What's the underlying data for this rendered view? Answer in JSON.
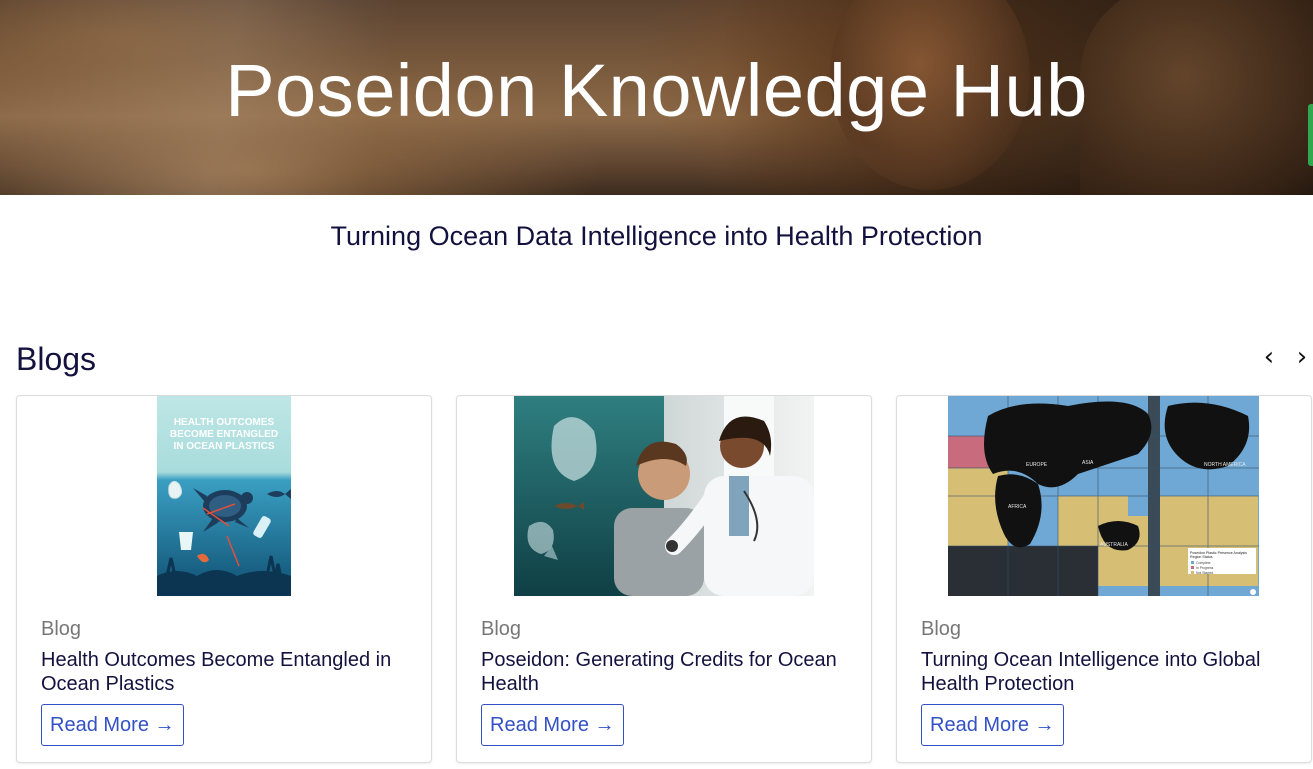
{
  "hero": {
    "title": "Poseidon Knowledge Hub"
  },
  "subtitle": "Turning Ocean Data Intelligence into Health Protection",
  "blogs": {
    "section_title": "Blogs",
    "prev_label": "‹",
    "next_label": "›",
    "cards": [
      {
        "tag": "Blog",
        "title": "Health Outcomes Become Entangled in Ocean Plastics",
        "read_more": "Read More →",
        "thumb_text": "HEALTH OUTCOMES BECOME ENTANGLED IN OCEAN PLASTICS"
      },
      {
        "tag": "Blog",
        "title": "Poseidon: Generating Credits for Ocean Health",
        "read_more": "Read More →"
      },
      {
        "tag": "Blog",
        "title": "Turning Ocean Intelligence into Global Health Protection",
        "read_more": "Read More →",
        "map_labels": [
          "EUROPE",
          "ASIA",
          "AFRICA",
          "NORTH AMERICA",
          "AUSTRALIA"
        ],
        "map_legend": {
          "title": "Poseidon Plastic Presence Analysis Region Status",
          "items": [
            "Complete",
            "In Progress",
            "Not Started"
          ]
        }
      }
    ]
  },
  "colors": {
    "heading": "#13123f",
    "link": "#3351c4",
    "tag": "#777777",
    "accent_tab": "#2fa84f"
  }
}
